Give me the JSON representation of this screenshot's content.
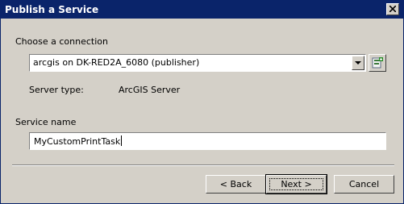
{
  "window": {
    "title": "Publish a Service"
  },
  "connection": {
    "label": "Choose a connection",
    "selected": "arcgis on DK-RED2A_6080 (publisher)",
    "add_icon": "add-connection-icon"
  },
  "server": {
    "type_label": "Server type:",
    "type_value": "ArcGIS Server"
  },
  "service": {
    "name_label": "Service name",
    "name_value": "MyCustomPrintTask"
  },
  "buttons": {
    "back": "< Back",
    "next": "Next >",
    "cancel": "Cancel"
  },
  "colors": {
    "titlebar": "#0a246a",
    "face": "#d4d0c8"
  }
}
